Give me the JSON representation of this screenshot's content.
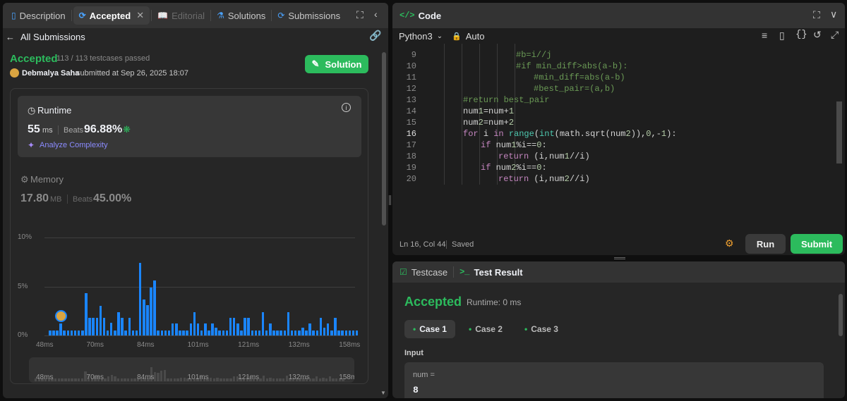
{
  "left": {
    "tabs": [
      {
        "label": "Description",
        "icon": "description-icon"
      },
      {
        "label": "Accepted",
        "icon": "history-icon"
      },
      {
        "label": "Editorial",
        "icon": "book-icon"
      },
      {
        "label": "Solutions",
        "icon": "flask-icon"
      },
      {
        "label": "Submissions",
        "icon": "history-icon"
      }
    ],
    "back_label": "All Submissions",
    "status": "Accepted",
    "testcases": "113 / 113 testcases passed",
    "user": "Debmalya Saha",
    "submitted_at": "submitted at Sep 26, 2025 18:07",
    "solution_btn": "Solution",
    "runtime": {
      "title": "Runtime",
      "value": "55",
      "unit": "ms",
      "beats_label": "Beats",
      "beats": "96.88%",
      "analyze": "Analyze Complexity"
    },
    "memory": {
      "title": "Memory",
      "value": "17.80",
      "unit": "MB",
      "beats_label": "Beats",
      "beats": "45.00%"
    },
    "chart_data": {
      "type": "bar",
      "yticks": [
        "10%",
        "5%",
        "0%"
      ],
      "ylim": [
        0,
        10
      ],
      "xticks": [
        "48ms",
        "70ms",
        "84ms",
        "101ms",
        "121ms",
        "132ms",
        "158ms"
      ],
      "values": [
        0.5,
        0.5,
        0.5,
        1.2,
        0.5,
        0.5,
        0.5,
        0.5,
        0.5,
        0.5,
        4.3,
        1.8,
        1.8,
        1.8,
        3.0,
        1.8,
        0.5,
        1.3,
        0.5,
        2.4,
        1.8,
        0.5,
        1.8,
        0.5,
        0.5,
        7.4,
        3.7,
        3.1,
        4.9,
        5.6,
        0.5,
        0.5,
        0.5,
        0.5,
        1.2,
        1.2,
        0.5,
        0.5,
        0.5,
        1.2,
        2.4,
        1.2,
        0.5,
        1.2,
        0.5,
        1.2,
        0.8,
        0.5,
        0.5,
        0.5,
        1.8,
        1.8,
        1.2,
        0.5,
        1.8,
        1.8,
        0.5,
        0.5,
        0.5,
        2.4,
        0.5,
        1.2,
        0.5,
        0.5,
        0.5,
        0.5,
        2.4,
        0.5,
        0.5,
        0.5,
        0.8,
        0.5,
        1.2,
        0.5,
        0.5,
        1.8,
        0.8,
        1.2,
        0.5,
        1.8,
        0.5,
        0.5,
        0.5,
        0.5,
        0.5,
        0.5
      ],
      "highlight_index": 3,
      "mini_values": [
        0.3,
        0.3,
        0.3,
        0.3,
        0.3,
        0.3,
        0.3,
        0.3,
        0.3,
        0.3,
        0.3,
        0.3,
        0.3,
        0.3,
        0.3,
        2.0,
        1.2,
        0.3,
        0.8,
        1.0,
        0.3,
        0.3,
        0.8,
        1.2,
        0.8,
        0.3,
        0.3,
        0.3,
        0.3,
        0.3,
        0.3,
        0.3,
        0.3,
        0.3,
        0.3,
        3.0,
        1.8,
        1.6,
        2.1,
        2.4,
        0.3,
        0.3,
        0.3,
        0.3,
        0.5,
        0.5,
        0.3,
        0.3,
        0.3,
        0.5,
        1.0,
        0.5,
        0.3,
        0.5,
        0.3,
        0.5,
        0.3,
        0.3,
        0.3,
        0.3,
        0.8,
        0.8,
        0.5,
        0.3,
        0.8,
        0.8,
        0.3,
        0.3,
        0.3,
        1.0,
        0.3,
        0.5,
        0.3,
        0.3,
        0.3,
        0.3,
        1.0,
        0.3,
        0.3,
        0.3,
        0.3,
        0.3,
        0.5,
        0.3,
        0.3,
        0.8,
        0.3,
        0.5,
        0.3,
        0.8,
        0.3,
        0.3,
        0.3,
        0.3
      ]
    }
  },
  "code_panel": {
    "title": "Code",
    "language": "Python3",
    "mode": "Auto",
    "lines": [
      {
        "n": "9",
        "text": "#b=i//j",
        "indent": 5,
        "kind": "comment"
      },
      {
        "n": "10",
        "text": "#if min_diff>abs(a-b):",
        "indent": 5,
        "kind": "comment"
      },
      {
        "n": "11",
        "text": "#min_diff=abs(a-b)",
        "indent": 6,
        "kind": "comment"
      },
      {
        "n": "12",
        "text": "#best_pair=(a,b)",
        "indent": 6,
        "kind": "comment"
      },
      {
        "n": "13",
        "text": "#return best_pair",
        "indent": 2,
        "kind": "comment"
      },
      {
        "n": "14",
        "text": "num1=num+1",
        "indent": 2,
        "kind": "code"
      },
      {
        "n": "15",
        "text": "num2=num+2",
        "indent": 2,
        "kind": "code"
      },
      {
        "n": "16",
        "text": "for i in range(int(math.sqrt(num2)),0,-1):",
        "indent": 2,
        "kind": "for"
      },
      {
        "n": "17",
        "text": "if num1%i==0:",
        "indent": 3,
        "kind": "if"
      },
      {
        "n": "18",
        "text": "return (i,num1//i)",
        "indent": 4,
        "kind": "return"
      },
      {
        "n": "19",
        "text": "if num2%i==0:",
        "indent": 3,
        "kind": "if"
      },
      {
        "n": "20",
        "text": "return (i,num2//i)",
        "indent": 4,
        "kind": "return"
      }
    ],
    "status_pos": "Ln 16, Col 44",
    "status_saved": "Saved",
    "run_btn": "Run",
    "submit_btn": "Submit"
  },
  "result_panel": {
    "tab_testcase": "Testcase",
    "tab_result": "Test Result",
    "status": "Accepted",
    "runtime": "Runtime: 0 ms",
    "cases": [
      "Case 1",
      "Case 2",
      "Case 3"
    ],
    "input_label": "Input",
    "param_name": "num =",
    "param_value": "8"
  },
  "colors": {
    "accent_green": "#2cbb5d",
    "bar_blue": "#1a85ff",
    "tab_blue": "#4aa3ff"
  }
}
